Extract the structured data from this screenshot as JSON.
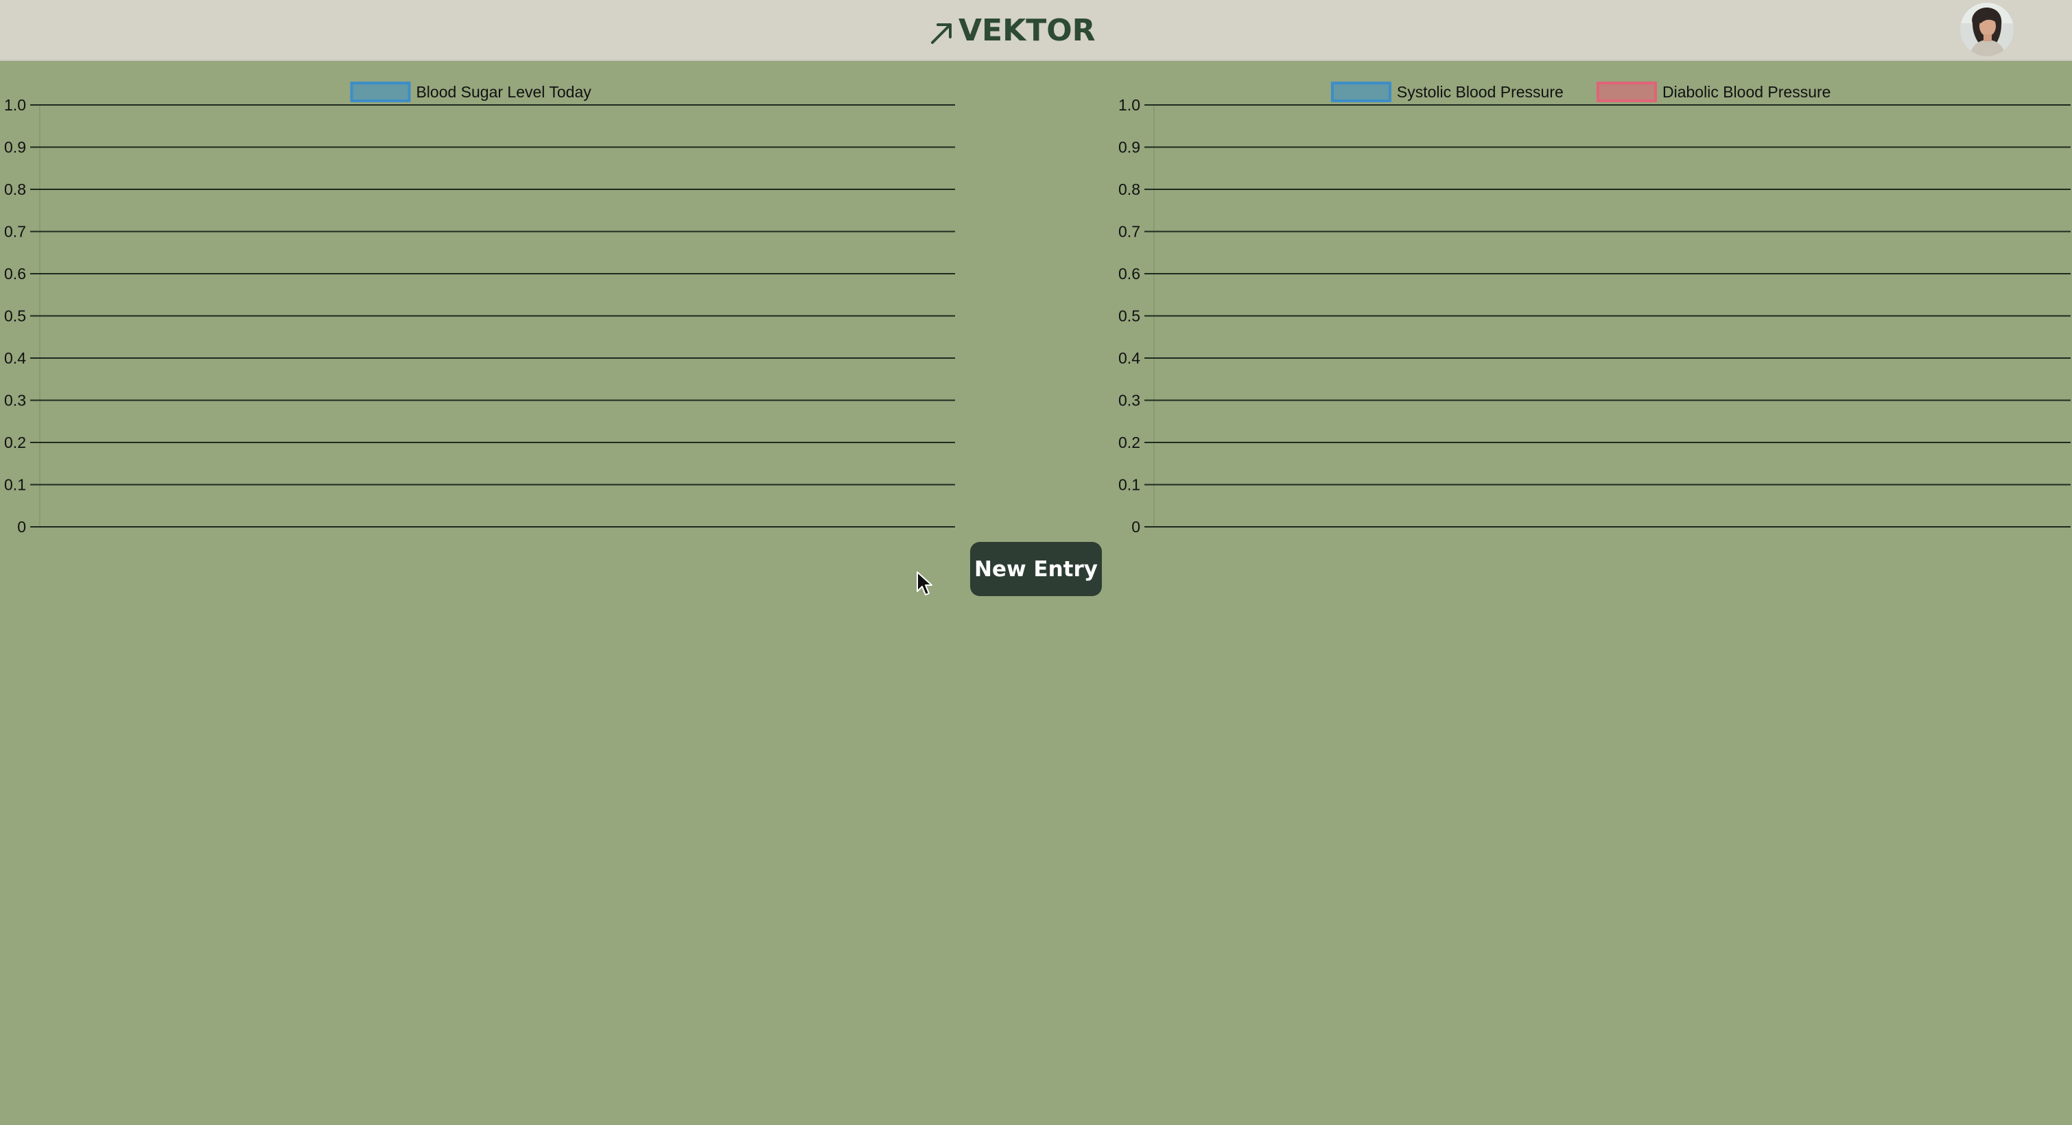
{
  "app": {
    "brand_name": "VEKTOR",
    "brand_icon": "arrow-up-right-icon",
    "avatar_icon": "user-avatar-photo"
  },
  "colors": {
    "header_bg": "#d5d2c8",
    "page_bg": "#96a67d",
    "brand_text": "#2d4a35",
    "button_bg": "#2d3d33",
    "series_blue": "#3d8ec8",
    "series_red": "#e06478"
  },
  "actions": {
    "new_entry_label": "New Entry"
  },
  "chart_data": [
    {
      "type": "line",
      "title": "",
      "xlabel": "",
      "ylabel": "",
      "ylim": [
        0,
        1
      ],
      "y_ticks": [
        "0",
        "0.1",
        "0.2",
        "0.3",
        "0.4",
        "0.5",
        "0.6",
        "0.7",
        "0.8",
        "0.9",
        "1.0"
      ],
      "grid": true,
      "legend_position": "top-center",
      "series": [
        {
          "name": "Blood Sugar Level Today",
          "color": "#3d8ec8",
          "values": []
        }
      ]
    },
    {
      "type": "line",
      "title": "",
      "xlabel": "",
      "ylabel": "",
      "ylim": [
        0,
        1
      ],
      "y_ticks": [
        "0",
        "0.1",
        "0.2",
        "0.3",
        "0.4",
        "0.5",
        "0.6",
        "0.7",
        "0.8",
        "0.9",
        "1.0"
      ],
      "grid": true,
      "legend_position": "top-center",
      "series": [
        {
          "name": "Systolic Blood Pressure",
          "color": "#3d8ec8",
          "values": []
        },
        {
          "name": "Diabolic Blood Pressure",
          "color": "#e06478",
          "values": []
        }
      ]
    }
  ]
}
